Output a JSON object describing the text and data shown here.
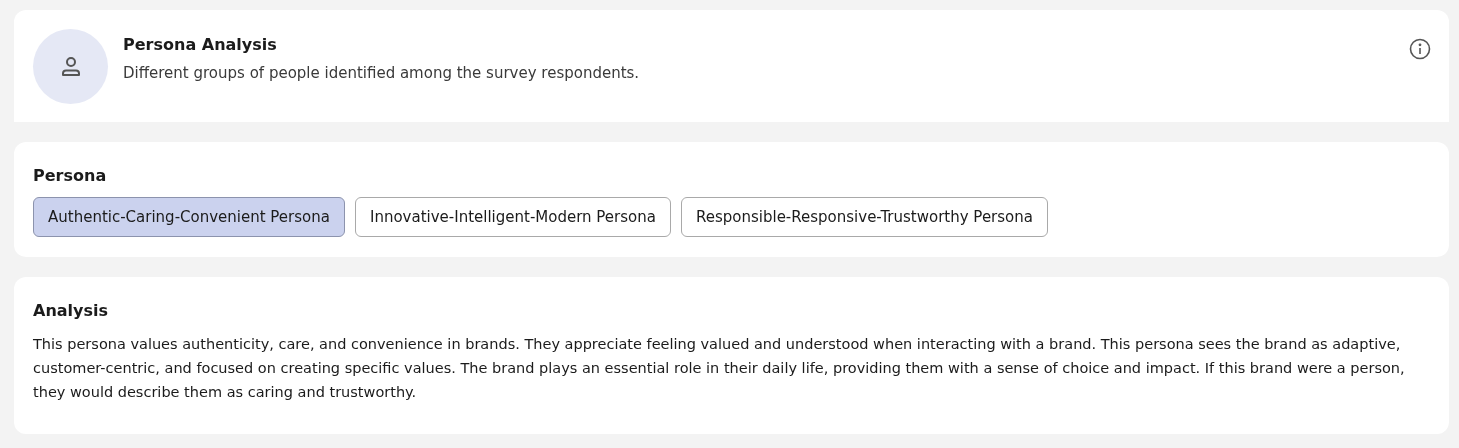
{
  "header": {
    "title": "Persona Analysis",
    "subtitle": "Different groups of people identified among the survey respondents."
  },
  "persona": {
    "heading": "Persona",
    "options": [
      {
        "label": "Authentic-Caring-Convenient Persona",
        "selected": true
      },
      {
        "label": "Innovative-Intelligent-Modern Persona",
        "selected": false
      },
      {
        "label": "Responsible-Responsive-Trustworthy Persona",
        "selected": false
      }
    ]
  },
  "analysis": {
    "heading": "Analysis",
    "text": "This persona values authenticity, care, and convenience in brands. They appreciate feeling valued and understood when interacting with a brand. This persona sees the brand as adaptive, customer-centric, and focused on creating specific values. The brand plays an essential role in their daily life, providing them with a sense of choice and impact. If this brand were a person, they would describe them as caring and trustworthy."
  }
}
